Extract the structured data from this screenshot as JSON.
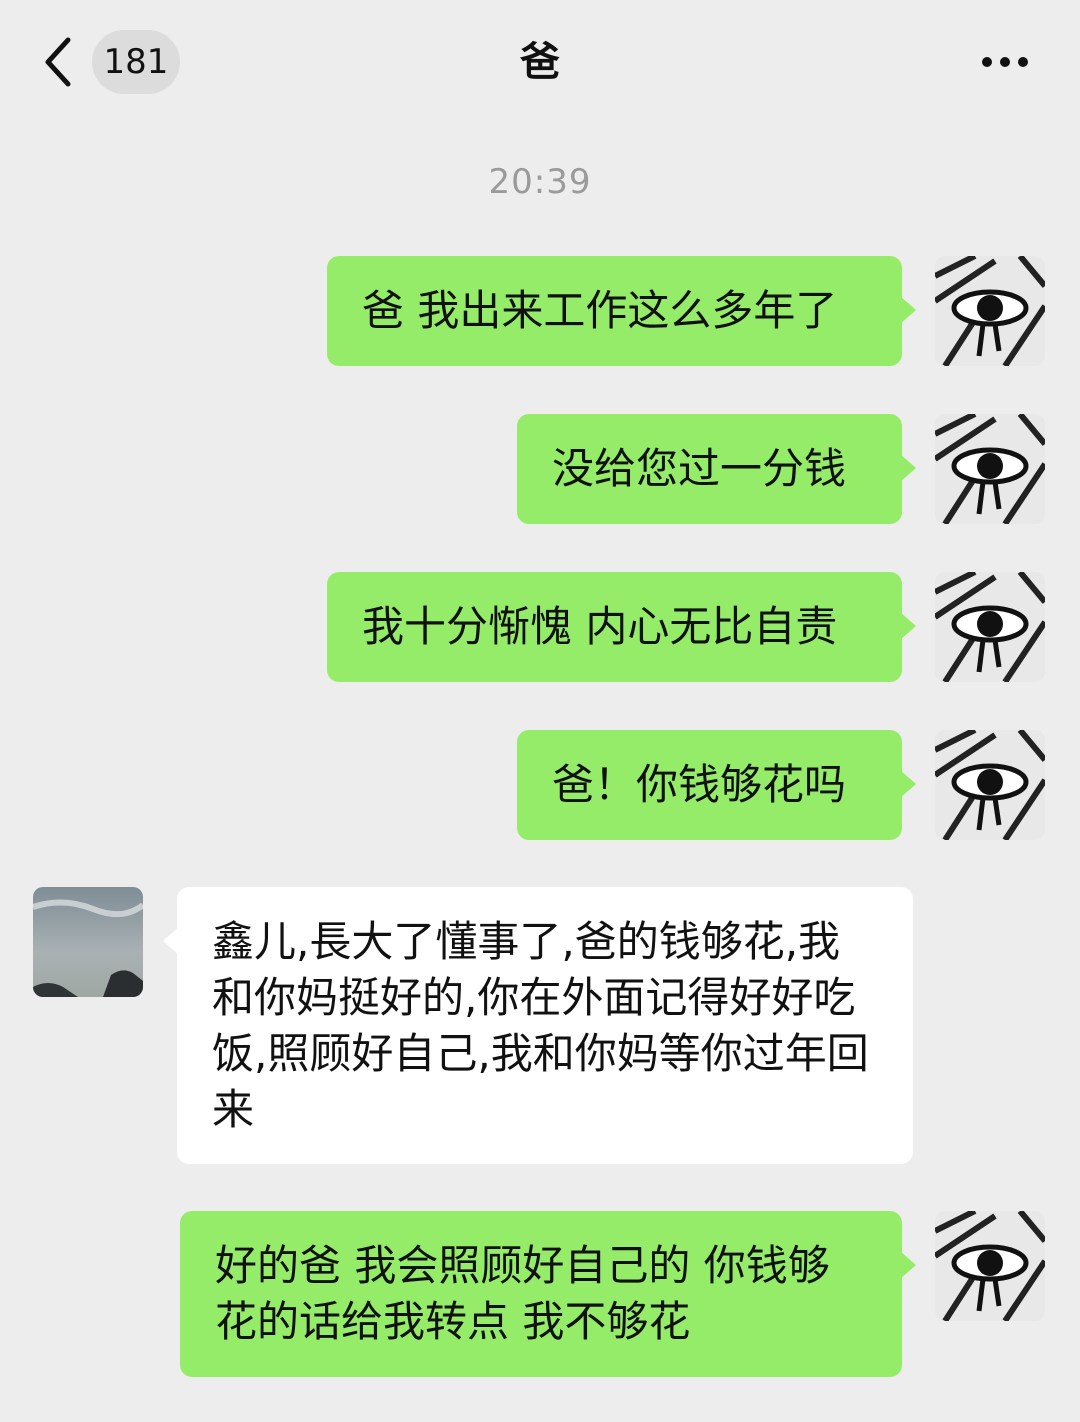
{
  "header": {
    "back_icon": "chevron-left-icon",
    "unread_count": "181",
    "title": "爸",
    "more_icon": "ellipsis-icon"
  },
  "timestamp": "20:39",
  "messages": [
    {
      "sender": "me",
      "text": "爸 我出来工作这么多年了"
    },
    {
      "sender": "me",
      "text": "没给您过一分钱"
    },
    {
      "sender": "me",
      "text": "我十分惭愧 内心无比自责"
    },
    {
      "sender": "me",
      "text": "爸！你钱够花吗"
    },
    {
      "sender": "other",
      "text": "鑫儿,長大了懂事了,爸的钱够花,我和你妈挺好的,你在外面记得好好吃饭,照顾好自己,我和你妈等你过年回来"
    },
    {
      "sender": "me",
      "text": "好的爸 我会照顾好自己的 你钱够花的话给我转点 我不够花"
    }
  ],
  "colors": {
    "background": "#ededed",
    "my_bubble": "#95ec69",
    "other_bubble": "#ffffff"
  }
}
